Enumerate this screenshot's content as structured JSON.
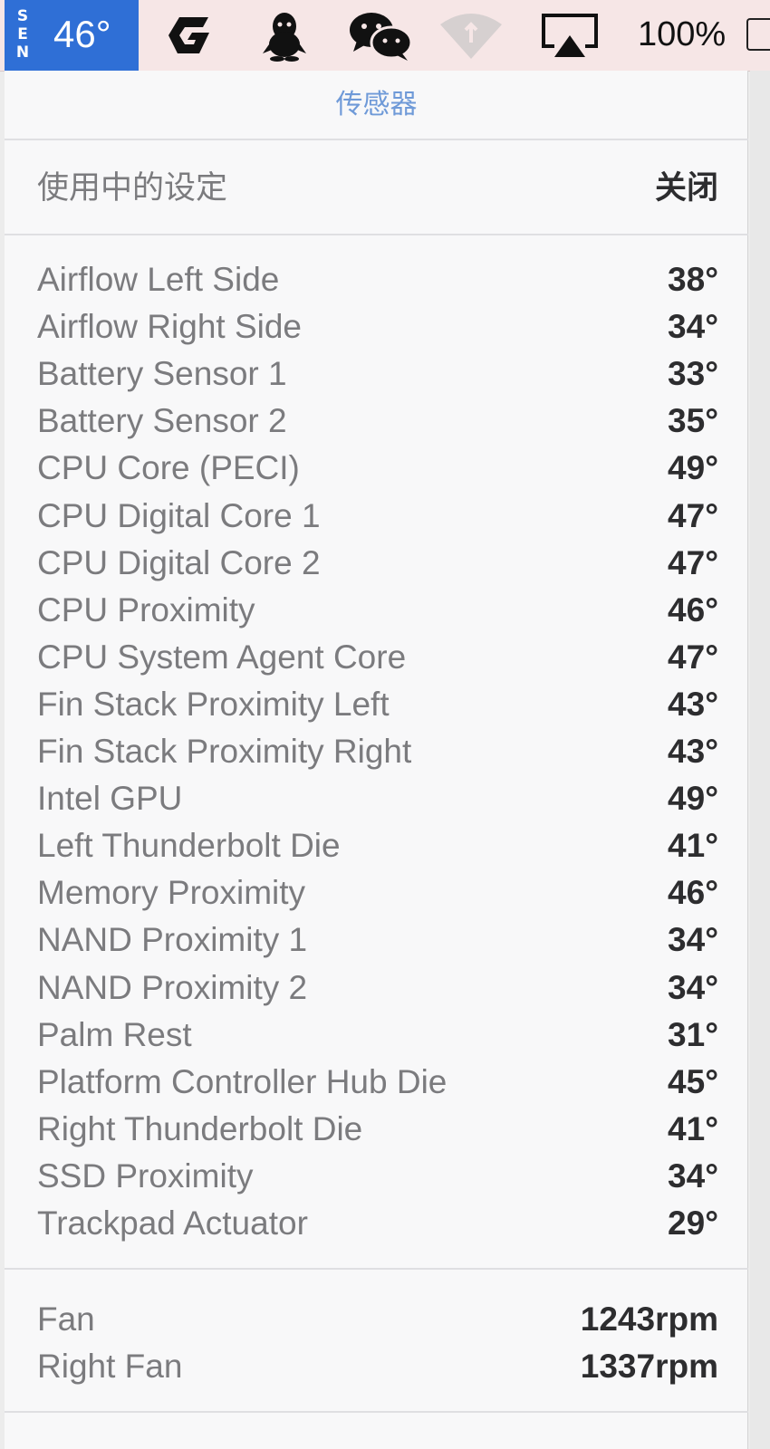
{
  "menubar": {
    "sen_letters": [
      "S",
      "E",
      "N"
    ],
    "temperature": "46°",
    "icons": [
      "app-g-icon",
      "qq-penguin-icon",
      "wechat-icon",
      "wifi-icon",
      "airplay-icon"
    ],
    "battery_percent": "100%",
    "accent_color": "#2f6fd6"
  },
  "panel": {
    "title": "传感器",
    "setting": {
      "label": "使用中的设定",
      "value": "关闭"
    },
    "sensors": [
      {
        "label": "Airflow Left Side",
        "value": "38°"
      },
      {
        "label": "Airflow Right Side",
        "value": "34°"
      },
      {
        "label": "Battery Sensor 1",
        "value": "33°"
      },
      {
        "label": "Battery Sensor 2",
        "value": "35°"
      },
      {
        "label": "CPU Core (PECI)",
        "value": "49°"
      },
      {
        "label": "CPU Digital Core 1",
        "value": "47°"
      },
      {
        "label": "CPU Digital Core 2",
        "value": "47°"
      },
      {
        "label": "CPU Proximity",
        "value": "46°"
      },
      {
        "label": "CPU System Agent Core",
        "value": "47°"
      },
      {
        "label": "Fin Stack Proximity Left",
        "value": "43°"
      },
      {
        "label": "Fin Stack Proximity Right",
        "value": "43°"
      },
      {
        "label": "Intel GPU",
        "value": "49°"
      },
      {
        "label": "Left Thunderbolt Die",
        "value": "41°"
      },
      {
        "label": "Memory Proximity",
        "value": "46°"
      },
      {
        "label": "NAND Proximity 1",
        "value": "34°"
      },
      {
        "label": "NAND Proximity 2",
        "value": "34°"
      },
      {
        "label": "Palm Rest",
        "value": "31°"
      },
      {
        "label": "Platform Controller Hub Die",
        "value": "45°"
      },
      {
        "label": "Right Thunderbolt Die",
        "value": "41°"
      },
      {
        "label": "SSD Proximity",
        "value": "34°"
      },
      {
        "label": "Trackpad Actuator",
        "value": "29°"
      }
    ],
    "fans": [
      {
        "label": "Fan",
        "value": "1243rpm"
      },
      {
        "label": "Right Fan",
        "value": "1337rpm"
      }
    ],
    "title_color": "#6f9ad8"
  }
}
